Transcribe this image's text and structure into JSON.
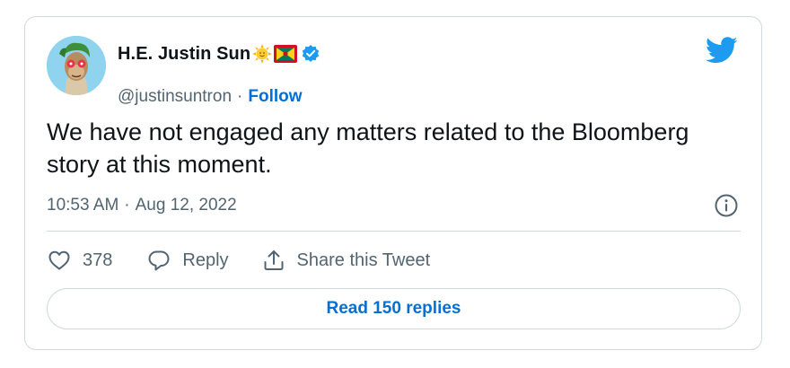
{
  "author": {
    "display_name": "H.E. Justin Sun",
    "name_emoji": "sun-emoji",
    "name_flag": "grenada-flag",
    "verified": true,
    "handle": "@justinsuntron",
    "separator": "·",
    "follow_label": "Follow"
  },
  "tweet": {
    "text": "We have not engaged any matters related to the Bloomberg story at this moment.",
    "time": "10:53 AM",
    "separator": "·",
    "date": "Aug 12, 2022"
  },
  "actions": {
    "like_count": "378",
    "reply_label": "Reply",
    "share_label": "Share this Tweet"
  },
  "read_replies_label": "Read 150 replies",
  "icons": {
    "brand": "twitter-bird-icon",
    "info": "info-icon",
    "like": "heart-icon",
    "reply": "speech-bubble-icon",
    "share": "share-upload-icon"
  },
  "colors": {
    "link_blue": "#006fd6",
    "twitter_blue": "#1d9bf0",
    "text_primary": "#0f1419",
    "text_secondary": "#536471",
    "border": "#cfd9de"
  }
}
